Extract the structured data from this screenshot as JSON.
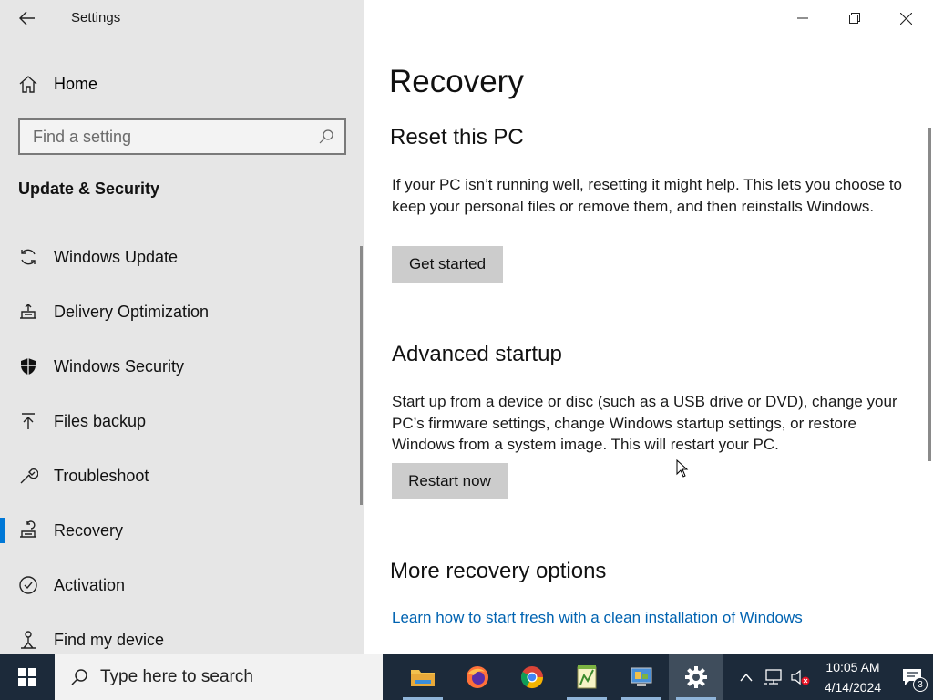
{
  "window": {
    "title": "Settings"
  },
  "sidebar": {
    "home_label": "Home",
    "search_placeholder": "Find a setting",
    "section_title": "Update & Security",
    "items": [
      {
        "label": "Windows Update",
        "icon": "refresh-icon"
      },
      {
        "label": "Delivery Optimization",
        "icon": "delivery-optimization-icon"
      },
      {
        "label": "Windows Security",
        "icon": "shield-icon"
      },
      {
        "label": "Files backup",
        "icon": "backup-arrow-icon"
      },
      {
        "label": "Troubleshoot",
        "icon": "wrench-icon"
      },
      {
        "label": "Recovery",
        "icon": "recovery-icon",
        "selected": true
      },
      {
        "label": "Activation",
        "icon": "check-circle-icon"
      },
      {
        "label": "Find my device",
        "icon": "find-device-icon"
      }
    ]
  },
  "main": {
    "page_title": "Recovery",
    "reset": {
      "heading": "Reset this PC",
      "description": "If your PC isn’t running well, resetting it might help. This lets you choose to keep your personal files or remove them, and then reinstalls Windows.",
      "button": "Get started"
    },
    "advanced": {
      "heading": "Advanced startup",
      "description": "Start up from a device or disc (such as a USB drive or DVD), change your PC’s firmware settings, change Windows startup settings, or restore Windows from a system image. This will restart your PC.",
      "button": "Restart now"
    },
    "more": {
      "heading": "More recovery options",
      "link": "Learn how to start fresh with a clean installation of Windows"
    }
  },
  "taskbar": {
    "search_placeholder": "Type here to search",
    "apps": [
      "file-explorer-icon",
      "firefox-icon",
      "chrome-icon",
      "notepad-plus-plus-icon",
      "control-panel-icon",
      "settings-gear-icon"
    ],
    "active_app": "settings-gear-icon",
    "time": "10:05 AM",
    "date": "4/14/2024",
    "notification_count": "3"
  },
  "colors": {
    "accent": "#0078d7",
    "link": "#0063b1",
    "sidebar_bg": "#e6e6e6",
    "taskbar_bg": "#1c2a3a"
  }
}
